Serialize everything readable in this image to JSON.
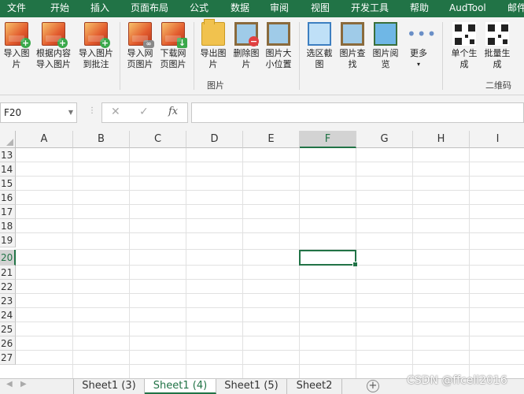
{
  "ribbon_tabs": [
    "文件",
    "开始",
    "插入",
    "页面布局",
    "公式",
    "数据",
    "审阅",
    "视图",
    "开发工具",
    "帮助",
    "AudTool",
    "邮件"
  ],
  "ribbon": {
    "buttons": [
      {
        "label": "导入图片",
        "icon": "import-picture-icon"
      },
      {
        "label": "根据内容导入图片",
        "icon": "import-by-content-icon"
      },
      {
        "label": "导入图片到批注",
        "icon": "import-to-comment-icon"
      },
      {
        "label": "导入网页图片",
        "icon": "import-web-picture-icon"
      },
      {
        "label": "下载网页图片",
        "icon": "download-web-picture-icon"
      },
      {
        "label": "导出图片",
        "icon": "export-picture-icon"
      },
      {
        "label": "删除图片",
        "icon": "delete-picture-icon"
      },
      {
        "label": "图片大小位置",
        "icon": "picture-size-icon"
      },
      {
        "label": "选区截图",
        "icon": "screenshot-icon"
      },
      {
        "label": "图片查找",
        "icon": "picture-find-icon"
      },
      {
        "label": "图片阅览",
        "icon": "picture-browse-icon"
      },
      {
        "label": "更多",
        "icon": "more-dots-icon"
      },
      {
        "label": "单个生成",
        "icon": "qr-single-icon"
      },
      {
        "label": "批量生成",
        "icon": "qr-batch-icon"
      }
    ],
    "group_picture": "图片",
    "group_qrcode": "二维码"
  },
  "formula_bar": {
    "name_box": "F20",
    "cancel_symbol": "✕",
    "enter_symbol": "✓",
    "fx_symbol": "fx",
    "formula": ""
  },
  "grid": {
    "columns": [
      "A",
      "B",
      "C",
      "D",
      "E",
      "F",
      "G",
      "H",
      "I"
    ],
    "selected_column": "F",
    "rows": [
      "13",
      "14",
      "15",
      "16",
      "17",
      "18",
      "19",
      "20",
      "21",
      "22",
      "23",
      "24",
      "25",
      "26",
      "27"
    ],
    "selected_row": "20",
    "active_cell": "F20"
  },
  "sheet_tabs": [
    "Sheet1 (3)",
    "Sheet1 (4)",
    "Sheet1 (5)",
    "Sheet2"
  ],
  "active_sheet": "Sheet1 (4)",
  "watermark": "CSDN @ffcell2016",
  "colors": {
    "excel_green": "#217346",
    "ribbon_bg": "#f3f3f3"
  }
}
